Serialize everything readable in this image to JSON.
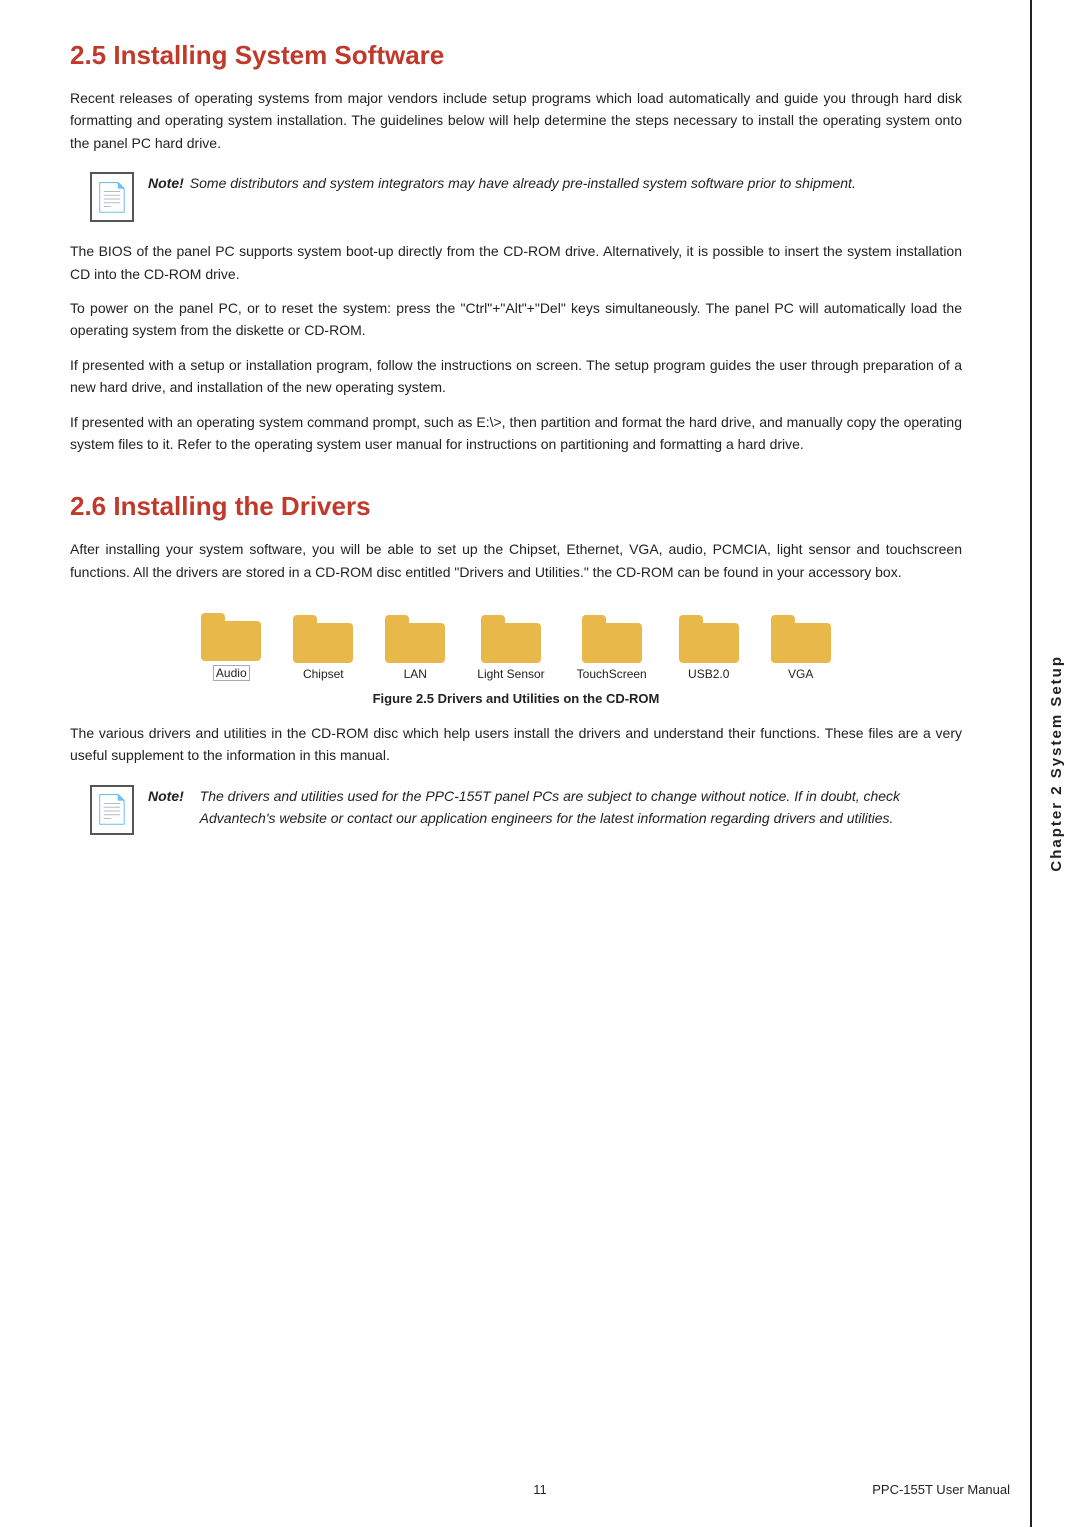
{
  "page": {
    "chapter_label": "Chapter 2  System Setup",
    "footer_page": "11",
    "footer_manual": "PPC-155T User Manual"
  },
  "section_25": {
    "heading": "2.5  Installing System Software",
    "para1": "Recent releases of operating systems from major vendors include setup programs which load automatically and guide you through hard disk formatting and operating system installation. The guidelines below will help determine the steps necessary to install the operating system onto the panel PC hard drive.",
    "note1_label": "Note!",
    "note1_text": "Some distributors and system integrators may have already pre-installed system software prior to shipment.",
    "para2": "The BIOS of the panel PC supports system boot-up directly from the CD-ROM drive. Alternatively, it is possible to insert the system installation CD into the CD-ROM drive.",
    "para3": "To power on the panel PC, or to reset the system: press the \"Ctrl\"+\"Alt\"+\"Del\" keys simultaneously. The panel PC will automatically load the operating system from the diskette or CD-ROM.",
    "para4": "If presented with a setup or installation program, follow the instructions on screen. The setup program guides the user through preparation of a new hard drive, and installation of the new operating system.",
    "para5": "If presented with an operating system command prompt, such as E:\\>, then partition and format the hard drive, and manually copy the operating system files to it. Refer to the operating system user manual for instructions on partitioning and formatting a hard drive."
  },
  "section_26": {
    "heading": "2.6  Installing the Drivers",
    "para1": "After installing your system software, you will be able to set up the Chipset, Ethernet, VGA, audio, PCMCIA, light sensor and touchscreen functions. All the drivers are stored in a CD-ROM disc entitled \"Drivers and Utilities.\"  the CD-ROM can be found in your accessory box.",
    "folders": [
      {
        "label": "Audio",
        "selected": true
      },
      {
        "label": "Chipset",
        "selected": false
      },
      {
        "label": "LAN",
        "selected": false
      },
      {
        "label": "Light Sensor",
        "selected": false
      },
      {
        "label": "TouchScreen",
        "selected": false
      },
      {
        "label": "USB2.0",
        "selected": false
      },
      {
        "label": "VGA",
        "selected": false
      }
    ],
    "figure_caption": "Figure 2.5 Drivers and Utilities on the CD-ROM",
    "para2": "The various drivers and utilities in the CD-ROM disc which help users install the drivers and understand their functions. These files are a very useful supplement to the information in this manual.",
    "note2_label": "Note!",
    "note2_text": "The drivers and utilities used for the PPC-155T panel PCs are subject to change without notice. If in doubt, check Advantech's website or contact our application engineers for the latest information regarding drivers and utilities."
  }
}
